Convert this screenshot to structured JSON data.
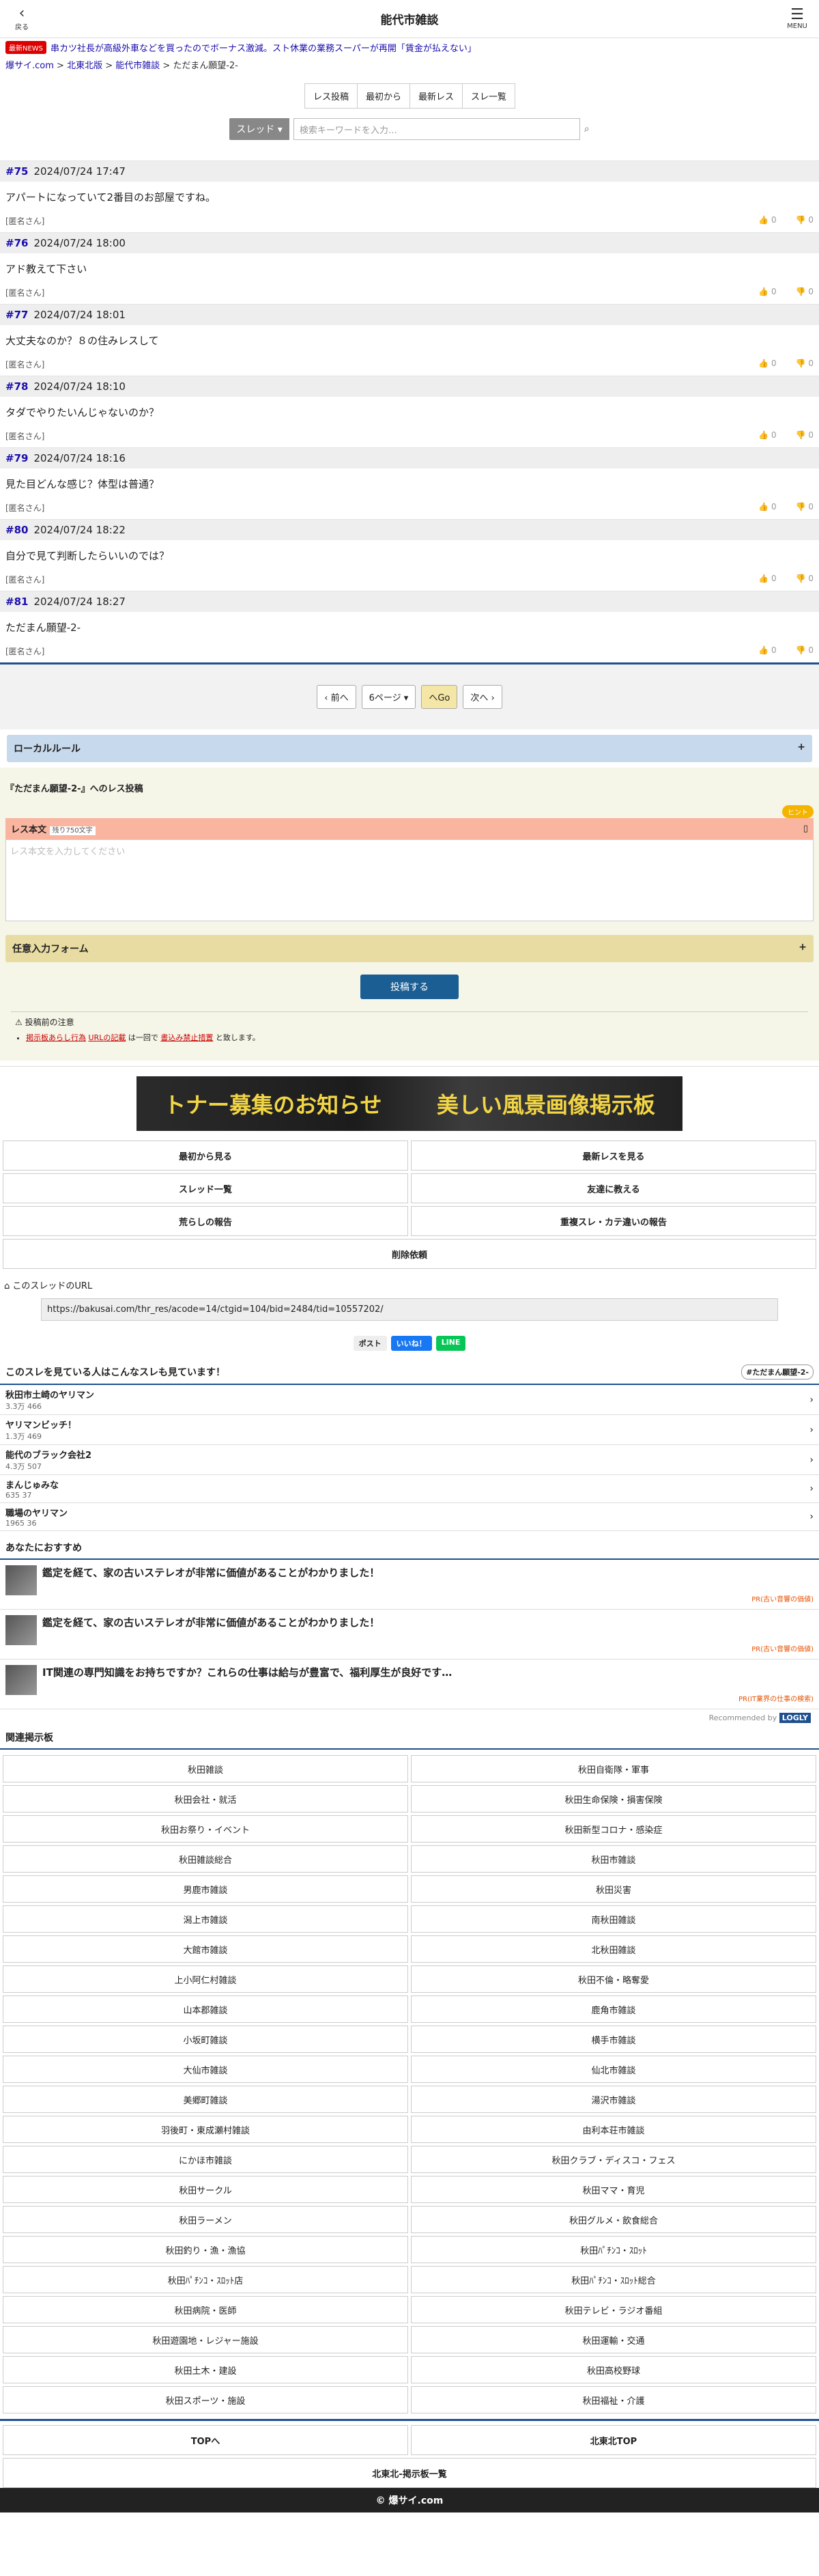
{
  "header": {
    "back_label": "戻る",
    "back_icon": "‹",
    "title": "能代市雑談",
    "menu_label": "MENU",
    "menu_icon": "☰"
  },
  "news": {
    "tag": "最新NEWS",
    "text": "串カツ社長が高級外車などを買ったのでボーナス激減。スト休業の業務スーパーが再開「賃金が払えない」"
  },
  "breadcrumb": {
    "items": [
      "爆サイ.com",
      "北東北版",
      "能代市雑談",
      "ただまん願望-2-"
    ],
    "sep": " > "
  },
  "top_buttons": [
    "レス投稿",
    "最初から",
    "最新レス",
    "スレ一覧"
  ],
  "search": {
    "select": "スレッド ▾",
    "placeholder": "検索キーワードを入力…",
    "go": "⌕"
  },
  "posts": [
    {
      "no": "#75",
      "date": "2024/07/24 17:47",
      "body": "アパートになっていて2番目のお部屋ですね。",
      "name": "[匿名さん]",
      "up": "0",
      "down": "0"
    },
    {
      "no": "#76",
      "date": "2024/07/24 18:00",
      "body": "アド教えて下さい",
      "name": "[匿名さん]",
      "up": "0",
      "down": "0"
    },
    {
      "no": "#77",
      "date": "2024/07/24 18:01",
      "body": "大丈夫なのか？８の住みレスして",
      "name": "[匿名さん]",
      "up": "0",
      "down": "0"
    },
    {
      "no": "#78",
      "date": "2024/07/24 18:10",
      "body": "タダでやりたいんじゃないのか？",
      "name": "[匿名さん]",
      "up": "0",
      "down": "0"
    },
    {
      "no": "#79",
      "date": "2024/07/24 18:16",
      "body": "見た目どんな感じ？体型は普通？",
      "name": "[匿名さん]",
      "up": "0",
      "down": "0"
    },
    {
      "no": "#80",
      "date": "2024/07/24 18:22",
      "body": "自分で見て判断したらいいのでは？",
      "name": "[匿名さん]",
      "up": "0",
      "down": "0"
    },
    {
      "no": "#81",
      "date": "2024/07/24 18:27",
      "body": "ただまん願望-2-",
      "name": "[匿名さん]",
      "up": "0",
      "down": "0"
    }
  ],
  "pager": {
    "prev": "‹ 前へ",
    "page": "6ページ ▾",
    "go": "へGo",
    "next": "次へ ›"
  },
  "local_rule": {
    "label": "ローカルルール",
    "icon": "+"
  },
  "form": {
    "title": "『ただまん願望-2-』へのレス投稿",
    "hint": "ヒント",
    "res_label": "レス本文",
    "remain": "残り750文字",
    "placeholder": "レス本文を入力してください",
    "optional": "任意入力フォーム",
    "optional_icon": "+",
    "submit": "投稿する"
  },
  "notice": {
    "title": "⚠ 投稿前の注意",
    "items": [
      "掲示板あらし行為",
      "URLの記載",
      "は一回で",
      "書込み禁止措置",
      "と致します。"
    ]
  },
  "banner": {
    "left": "トナー募集のお知らせ",
    "right": "美しい風景画像掲示板"
  },
  "action_buttons": [
    "最初から見る",
    "最新レスを見る",
    "スレッド一覧",
    "友達に教える",
    "荒らしの報告",
    "重複スレ・カテ違いの報告"
  ],
  "delete_request": "削除依頼",
  "url": {
    "label": "このスレッドのURL",
    "value": "https://bakusai.com/thr_res/acode=14/ctgid=104/bid=2484/tid=10557202/"
  },
  "share": {
    "x": "ポスト",
    "fb": "いいね！",
    "line": "LINE"
  },
  "related": {
    "title": "このスレを見ている人はこんなスレも見ています！",
    "tag": "#ただまん願望-2-",
    "items": [
      {
        "t": "秋田市土崎のヤリマン",
        "m": "3.3万 466"
      },
      {
        "t": "ヤリマンビッチ！",
        "m": "1.3万 469"
      },
      {
        "t": "能代のブラック会社2",
        "m": "4.3万 507"
      },
      {
        "t": "まんじゅみな",
        "m": "635 37"
      },
      {
        "t": "職場のヤリマン",
        "m": "1965 36"
      }
    ]
  },
  "recommend": {
    "title": "あなたにおすすめ",
    "items": [
      {
        "t": "鑑定を経て、家の古いステレオが非常に価値があることがわかりました！",
        "pr": "PR(古い音響の価値)"
      },
      {
        "t": "鑑定を経て、家の古いステレオが非常に価値があることがわかりました！",
        "pr": "PR(古い音響の価値)"
      },
      {
        "t": "IT関連の専門知識をお持ちですか？これらの仕事は給与が豊富で、福利厚生が良好です…",
        "pr": "PR(IT業界の仕事の検索)"
      }
    ],
    "by": "Recommended by",
    "brand": "LOGLY"
  },
  "boards": {
    "title": "関連掲示板",
    "items": [
      "秋田雑談",
      "秋田自衛隊・軍事",
      "秋田会社・就活",
      "秋田生命保険・損害保険",
      "秋田お祭り・イベント",
      "秋田新型コロナ・感染症",
      "秋田雑談総合",
      "秋田市雑談",
      "男鹿市雑談",
      "秋田災害",
      "潟上市雑談",
      "南秋田雑談",
      "大館市雑談",
      "北秋田雑談",
      "上小阿仁村雑談",
      "秋田不倫・略奪愛",
      "山本郡雑談",
      "鹿角市雑談",
      "小坂町雑談",
      "横手市雑談",
      "大仙市雑談",
      "仙北市雑談",
      "美郷町雑談",
      "湯沢市雑談",
      "羽後町・東成瀬村雑談",
      "由利本荘市雑談",
      "にかほ市雑談",
      "秋田クラブ・ディスコ・フェス",
      "秋田サークル",
      "秋田ママ・育児",
      "秋田ラーメン",
      "秋田グルメ・飲食総合",
      "秋田釣り・漁・漁協",
      "秋田ﾊﾟﾁﾝｺ・ｽﾛｯﾄ",
      "秋田ﾊﾟﾁﾝｺ・ｽﾛｯﾄ店",
      "秋田ﾊﾟﾁﾝｺ・ｽﾛｯﾄ総合",
      "秋田病院・医師",
      "秋田テレビ・ラジオ番組",
      "秋田遊園地・レジャー施設",
      "秋田運輸・交通",
      "秋田土木・建設",
      "秋田高校野球",
      "秋田スポーツ・施設",
      "秋田福祉・介護"
    ]
  },
  "nav": {
    "top": "TOPへ",
    "region_top": "北東北TOP",
    "list": "北東北-掲示板一覧"
  },
  "footer": "© 爆サイ.com"
}
